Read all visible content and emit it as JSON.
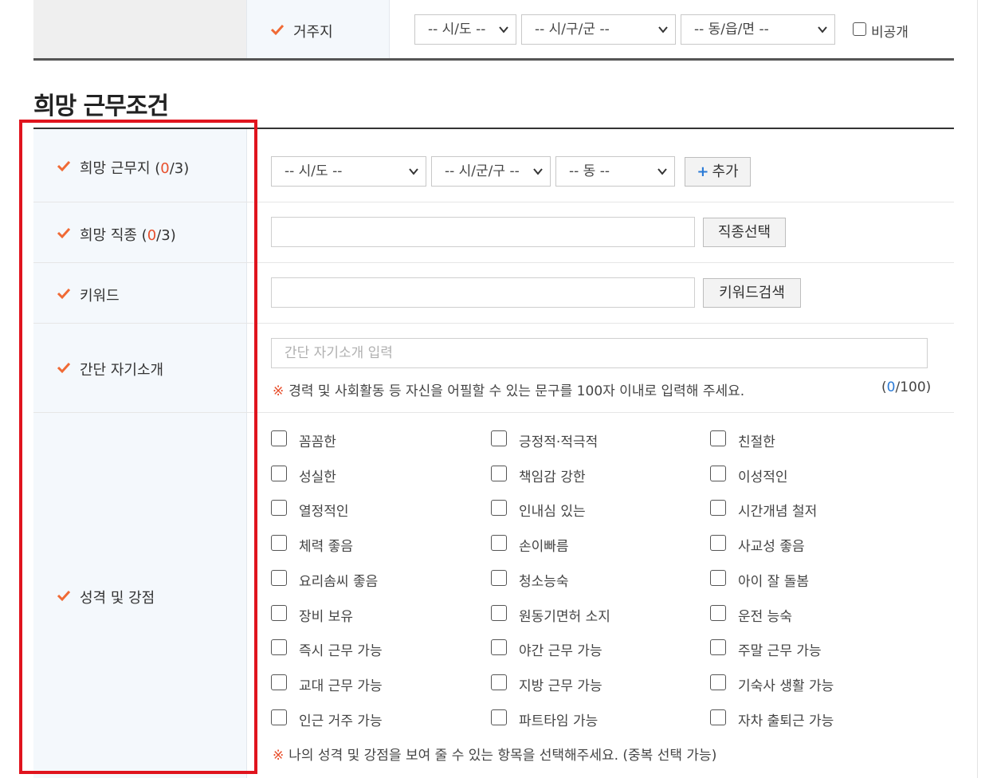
{
  "residence": {
    "label": "거주지",
    "sido": "-- 시/도 --",
    "sigungu": "-- 시/구/군 --",
    "dong": "-- 동/읍/면 --",
    "private_label": "비공개"
  },
  "section": {
    "title": "희망 근무조건"
  },
  "work_location": {
    "label_prefix": "희망 근무지 (",
    "count": "0",
    "label_suffix": "/3)",
    "sido": "-- 시/도 --",
    "sigungu": "-- 시/군/구 --",
    "dong": "-- 동 --",
    "add_button": "추가",
    "add_plus": "+"
  },
  "job_type": {
    "label_prefix": "희망 직종 (",
    "count": "0",
    "label_suffix": "/3)",
    "input_value": "",
    "button": "직종선택"
  },
  "keyword": {
    "label": "키워드",
    "input_value": "",
    "button": "키워드검색"
  },
  "intro": {
    "label": "간단 자기소개",
    "placeholder": "간단 자기소개 입력",
    "note_mark": "※",
    "note": "경력 및 사회활동 등 자신을 어필할 수 있는 문구를 100자 이내로 입력해 주세요.",
    "counter_open": "(",
    "counter_value": "0",
    "counter_max": "/100)"
  },
  "traits": {
    "label": "성격 및 강점",
    "items": [
      [
        "꼼꼼한",
        "긍정적·적극적",
        "친절한"
      ],
      [
        "성실한",
        "책임감 강한",
        "이성적인"
      ],
      [
        "열정적인",
        "인내심 있는",
        "시간개념 철저"
      ],
      [
        "체력 좋음",
        "손이빠름",
        "사교성 좋음"
      ],
      [
        "요리솜씨 좋음",
        "청소능숙",
        "아이 잘 돌봄"
      ],
      [
        "장비 보유",
        "원동기면허 소지",
        "운전 능숙"
      ],
      [
        "즉시 근무 가능",
        "야간 근무 가능",
        "주말 근무 가능"
      ],
      [
        "교대 근무 가능",
        "지방 근무 가능",
        "기숙사 생활 가능"
      ],
      [
        "인근 거주 가능",
        "파트타임 가능",
        "자차 출퇴근 가능"
      ]
    ],
    "note_mark": "※",
    "note": "나의 성격 및 강점을 보여 줄 수 있는 항목을 선택해주세요. (중복 선택 가능)"
  },
  "colors": {
    "accent_orange": "#f06a35",
    "count_red": "#e8502d",
    "link_blue": "#2a7ad6",
    "highlight_red": "#e0141e"
  }
}
